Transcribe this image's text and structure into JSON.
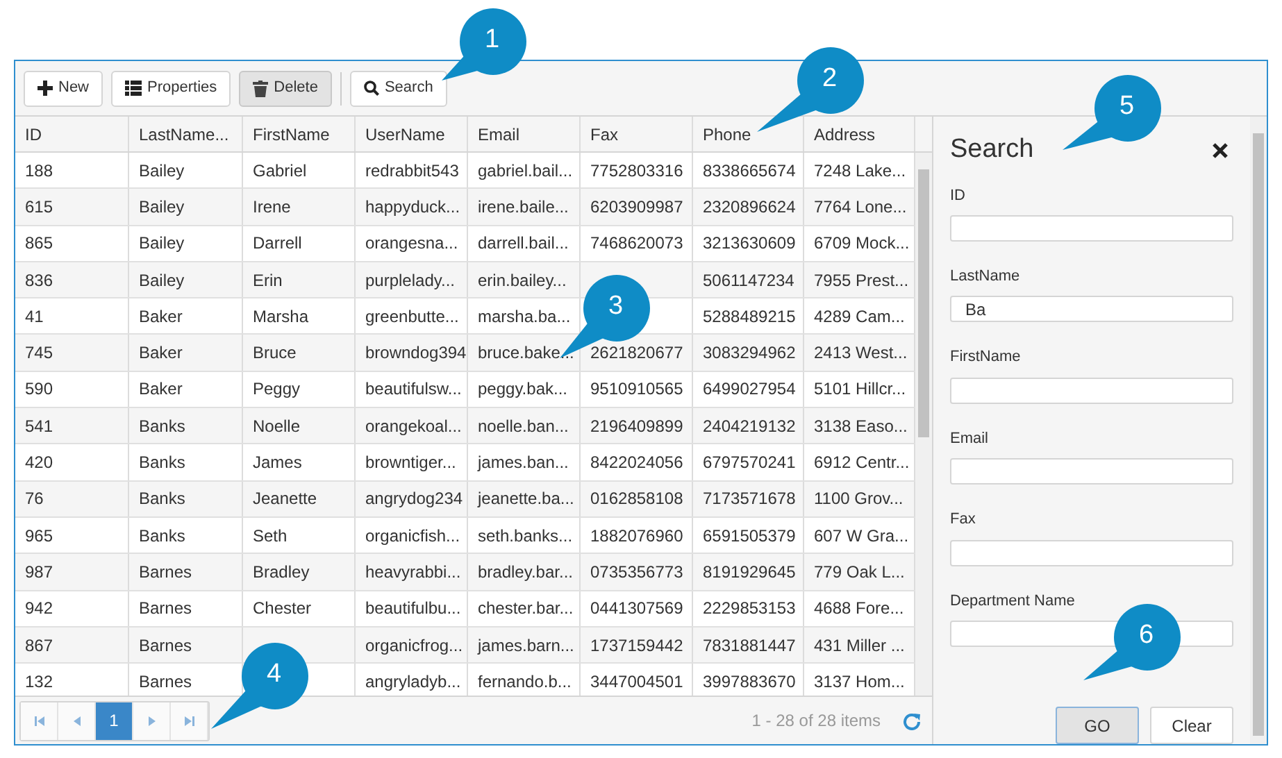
{
  "toolbar": [
    {
      "label": "New",
      "kind": "plus",
      "pressed": false
    },
    {
      "label": "Properties",
      "kind": "list",
      "pressed": false
    },
    {
      "label": "Delete",
      "kind": "trash",
      "pressed": true
    },
    {
      "label": "Search",
      "kind": "search",
      "pressed": false
    }
  ],
  "table": {
    "columns": [
      "ID",
      "LastName...",
      "FirstName",
      "UserName",
      "Email",
      "Fax",
      "Phone",
      "Address"
    ],
    "rows": [
      [
        "188",
        "Bailey",
        "Gabriel",
        "redrabbit543",
        "gabriel.bail...",
        "7752803316",
        "8338665674",
        "7248 Lake..."
      ],
      [
        "615",
        "Bailey",
        "Irene",
        "happyduck...",
        "irene.baile...",
        "6203909987",
        "2320896624",
        "7764 Lone..."
      ],
      [
        "865",
        "Bailey",
        "Darrell",
        "orangesna...",
        "darrell.bail...",
        "7468620073",
        "3213630609",
        "6709 Mock..."
      ],
      [
        "836",
        "Bailey",
        "Erin",
        "purplelady...",
        "erin.bailey...",
        "",
        "5061147234",
        "7955 Prest..."
      ],
      [
        "41",
        "Baker",
        "Marsha",
        "greenbutte...",
        "marsha.ba...",
        "",
        "5288489215",
        "4289 Cam..."
      ],
      [
        "745",
        "Baker",
        "Bruce",
        "browndog394",
        "bruce.bake...",
        "2621820677",
        "3083294962",
        "2413 West..."
      ],
      [
        "590",
        "Baker",
        "Peggy",
        "beautifulsw...",
        "peggy.bak...",
        "9510910565",
        "6499027954",
        "5101 Hillcr..."
      ],
      [
        "541",
        "Banks",
        "Noelle",
        "orangekoal...",
        "noelle.ban...",
        "2196409899",
        "2404219132",
        "3138 Easo..."
      ],
      [
        "420",
        "Banks",
        "James",
        "browntiger...",
        "james.ban...",
        "8422024056",
        "6797570241",
        "6912 Centr..."
      ],
      [
        "76",
        "Banks",
        "Jeanette",
        "angrydog234",
        "jeanette.ba...",
        "0162858108",
        "7173571678",
        "1100 Grov..."
      ],
      [
        "965",
        "Banks",
        "Seth",
        "organicfish...",
        "seth.banks...",
        "1882076960",
        "6591505379",
        "607 W Gra..."
      ],
      [
        "987",
        "Barnes",
        "Bradley",
        "heavyrabbi...",
        "bradley.bar...",
        "0735356773",
        "8191929645",
        "779 Oak L..."
      ],
      [
        "942",
        "Barnes",
        "Chester",
        "beautifulbu...",
        "chester.bar...",
        "0441307569",
        "2229853153",
        "4688 Fore..."
      ],
      [
        "867",
        "Barnes",
        "",
        "organicfrog...",
        "james.barn...",
        "1737159442",
        "7831881447",
        "431 Miller ..."
      ],
      [
        "132",
        "Barnes",
        "",
        "angryladyb...",
        "fernando.b...",
        "3447004501",
        "3997883670",
        "3137 Hom..."
      ]
    ]
  },
  "pager": {
    "buttons": [
      {
        "kind": "first",
        "selected": false
      },
      {
        "kind": "prev",
        "selected": false
      },
      {
        "kind": "page",
        "label": "1",
        "selected": true
      },
      {
        "kind": "next",
        "selected": false
      },
      {
        "kind": "last",
        "selected": false
      }
    ],
    "summary": "1 - 28 of 28 items"
  },
  "search_panel": {
    "title": "Search",
    "fields": [
      {
        "label": "ID"
      },
      {
        "label": "LastName",
        "value": "Ba"
      },
      {
        "label": "FirstName"
      },
      {
        "label": "Email"
      },
      {
        "label": "Fax"
      },
      {
        "label": "Department Name"
      }
    ],
    "buttons": [
      {
        "label": "GO",
        "focused": true
      },
      {
        "label": "Clear",
        "focused": false
      }
    ]
  },
  "callouts": [
    "1",
    "2",
    "3",
    "4",
    "5",
    "6"
  ]
}
